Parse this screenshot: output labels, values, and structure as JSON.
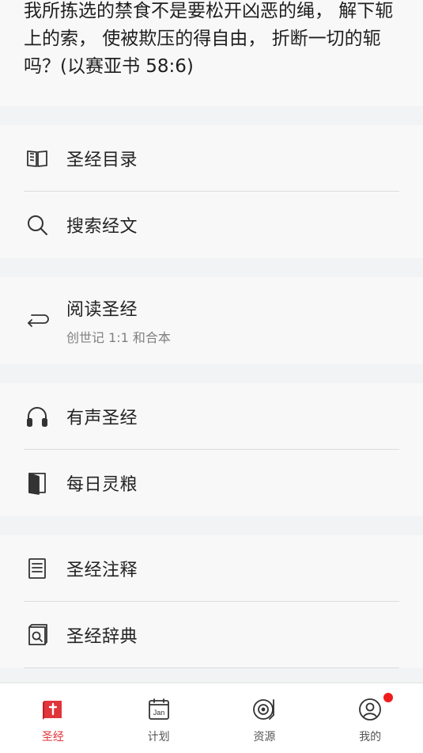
{
  "verse": {
    "text": "我所拣选的禁食不是要松开凶恶的绳， 解下轭上的索， 使被欺压的得自由， 折断一切的轭吗？(以赛亚书 58:6)"
  },
  "menu": {
    "group1": [
      {
        "label": "圣经目录",
        "icon": "book-open-icon"
      },
      {
        "label": "搜索经文",
        "icon": "search-icon"
      }
    ],
    "reading": {
      "label": "阅读圣经",
      "sub": "创世记 1:1 和合本",
      "icon": "return-arrow-icon"
    },
    "group3": [
      {
        "label": "有声圣经",
        "icon": "headphones-icon"
      },
      {
        "label": "每日灵粮",
        "icon": "door-icon"
      }
    ],
    "group4": [
      {
        "label": "圣经注释",
        "icon": "notes-document-icon"
      },
      {
        "label": "圣经辞典",
        "icon": "dictionary-search-icon"
      }
    ]
  },
  "tabs": [
    {
      "label": "圣经",
      "icon": "bible-icon",
      "active": true
    },
    {
      "label": "计划",
      "icon": "calendar-icon",
      "icon_text": "Jan",
      "active": false
    },
    {
      "label": "资源",
      "icon": "record-player-icon",
      "active": false
    },
    {
      "label": "我的",
      "icon": "profile-icon",
      "active": false,
      "badge": true
    }
  ],
  "colors": {
    "accent": "#e0353a",
    "badge": "#ef1c1c"
  }
}
